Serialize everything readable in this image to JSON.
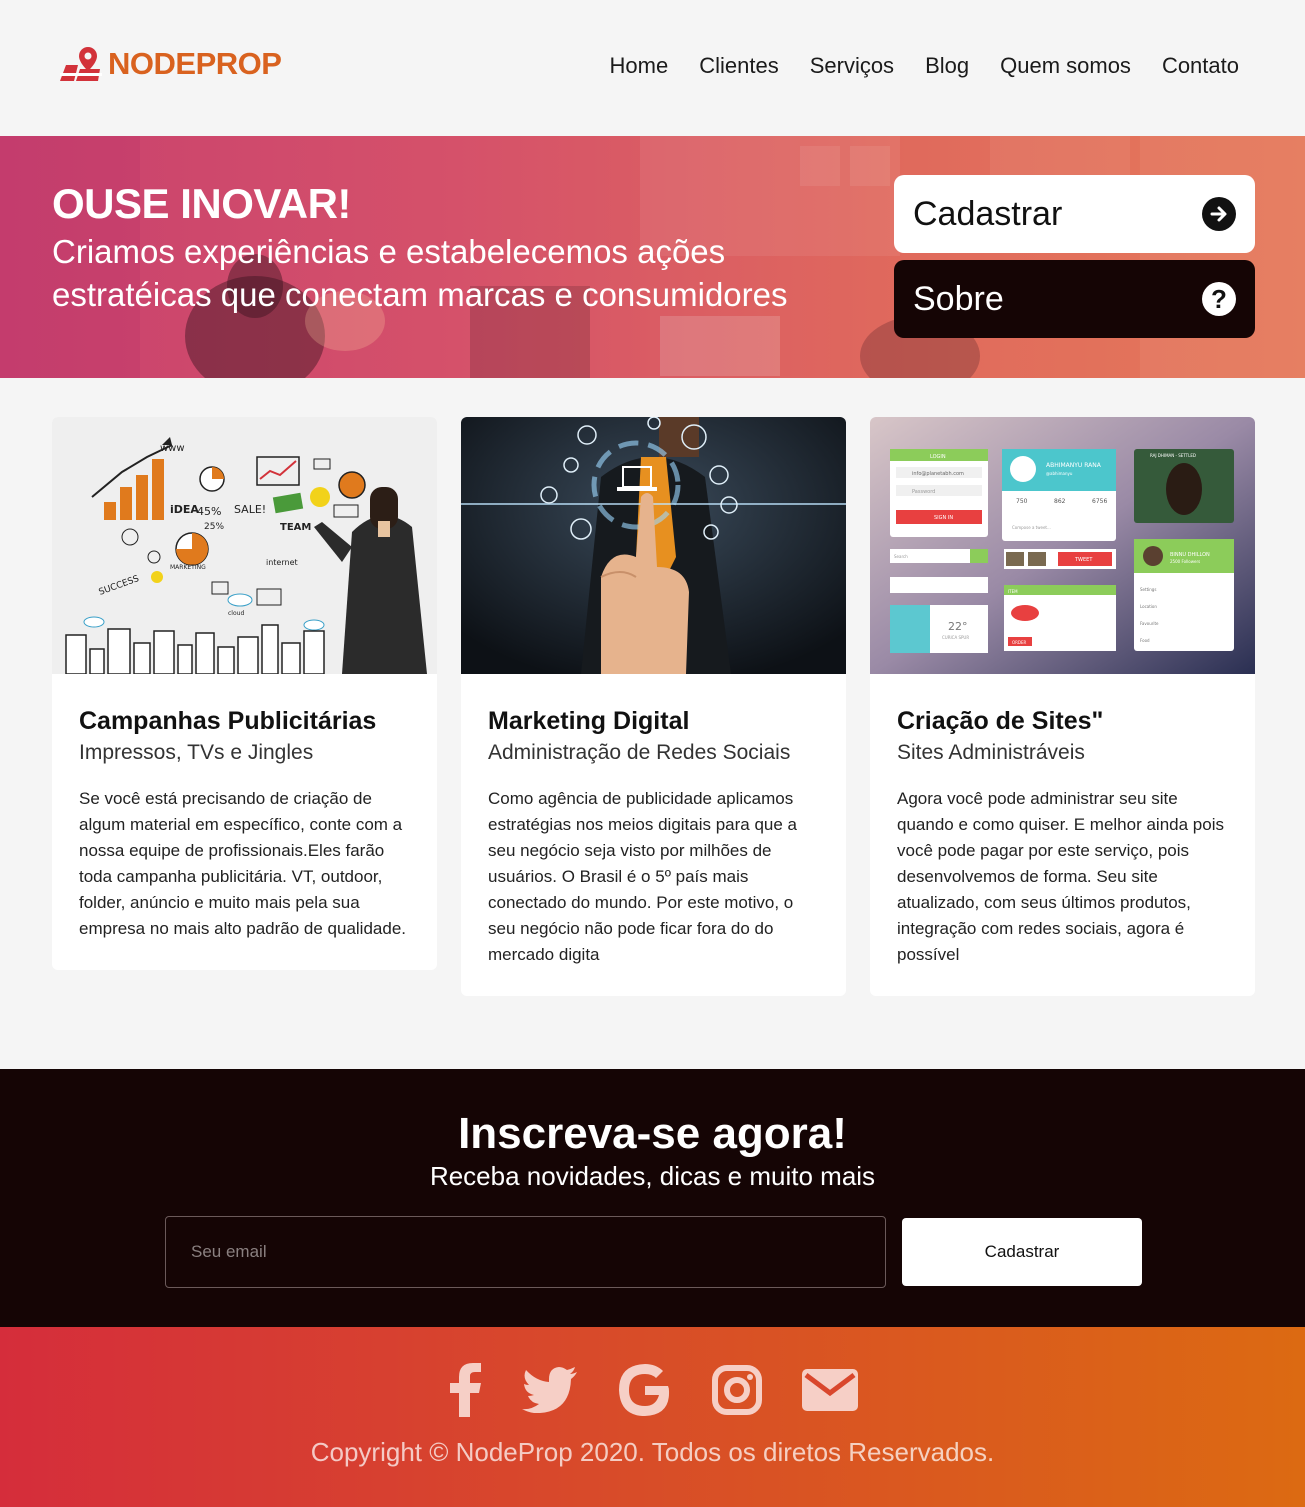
{
  "brand": {
    "name": "NODEPROP",
    "color": "#d9621f",
    "icon": "map-pin-logo-icon"
  },
  "nav": {
    "items": [
      {
        "label": "Home"
      },
      {
        "label": "Clientes"
      },
      {
        "label": "Serviços"
      },
      {
        "label": "Blog"
      },
      {
        "label": "Quem somos"
      },
      {
        "label": "Contato"
      }
    ]
  },
  "hero": {
    "title": "OUSE INOVAR!",
    "subtitle": "Criamos experiências e estabelecemos ações estratéicas que conectam marcas e consumidores",
    "cta_register": {
      "label": "Cadastrar",
      "icon": "arrow-right-circle-icon"
    },
    "cta_about": {
      "label": "Sobre",
      "icon": "question-circle-icon"
    }
  },
  "cards": [
    {
      "title": "Campanhas Publicitárias",
      "subtitle": "Impressos, TVs e Jingles",
      "text": "Se você está precisando de criação de algum material em específico, conte com a nossa equipe de profissionais.Eles farão toda campanha publicitária. VT, outdoor, folder, anúncio e muito mais pela sua empresa no mais alto padrão de qualidade.",
      "image_labels": [
        "www",
        "iDEA",
        "45%",
        "SALE!",
        "TEAM",
        "25%",
        "internet",
        "MARKETING",
        "SUCCESS",
        "cloud"
      ]
    },
    {
      "title": "Marketing Digital",
      "subtitle": "Administração de Redes Sociais",
      "text": "Como agência de publicidade aplicamos estratégias nos meios digitais para que a seu negócio seja visto por milhões de usuários. O Brasil é o 5º país mais conectado do mundo. Por este motivo, o seu negócio não pode ficar fora do do mercado digita"
    },
    {
      "title": "Criação de Sites\"",
      "subtitle": "Sites Administráveis",
      "text": "Agora você pode administrar seu site quando e como quiser. E melhor ainda pois você pode pagar por este serviço, pois desenvolvemos de forma. Seu site atualizado, com seus últimos produtos, integração com redes sociais, agora é possível",
      "image_labels": {
        "login": "LOGIN",
        "email": "info@planetabh.com",
        "password": "Password",
        "signin": "SIGN IN",
        "profile_name": "ABHIMANYU RANA",
        "profile_handle": "@abhimanyu",
        "stat1": "750",
        "stat2": "862",
        "stat3": "6756",
        "tweet": "TWEET",
        "compose": "Compose a tweet...",
        "search": "Search",
        "temp": "22°",
        "city": "CURICA SPUR",
        "item": "ITEM",
        "order": "ORDER",
        "user2": "BINNU DHILLON",
        "user2_sub": "2500 Followers",
        "menu1": "Settings",
        "menu2": "Location",
        "menu3": "Favourite",
        "menu4": "Food",
        "video_title": "RAJ DHIMAN - SETTLED"
      }
    }
  ],
  "newsletter": {
    "title": "Inscreva-se agora!",
    "subtitle": "Receba novidades, dicas e muito mais",
    "email_placeholder": "Seu email",
    "button_label": "Cadastrar"
  },
  "footer": {
    "socials": [
      "facebook-icon",
      "twitter-icon",
      "google-icon",
      "instagram-icon",
      "email-icon"
    ],
    "copyright": "Copyright © NodeProp 2020. Todos os diretos Reservados."
  },
  "colors": {
    "hero_start": "#c8416e",
    "hero_end": "#e5795a",
    "dark": "#150505",
    "footer_start": "#d52d3b",
    "footer_end": "#dc6a12"
  }
}
